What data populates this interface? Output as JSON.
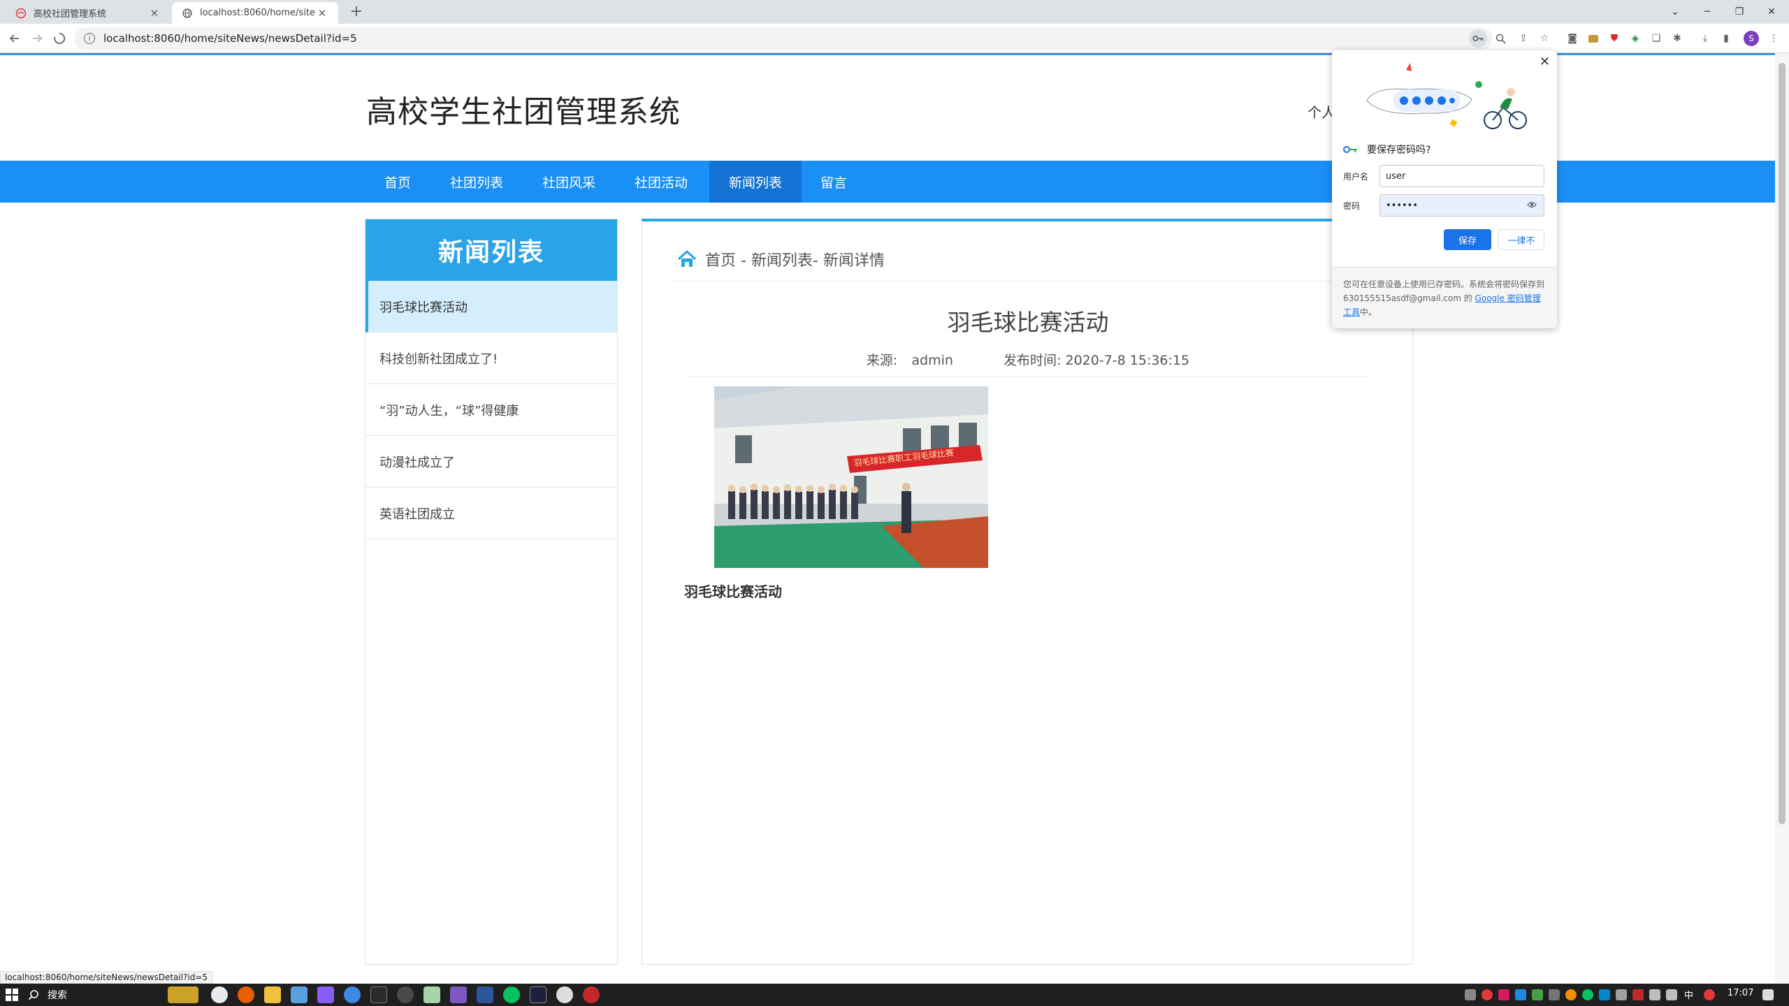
{
  "browser": {
    "tabs": [
      {
        "title": "高校社团管理系统",
        "active": false
      },
      {
        "title": "localhost:8060/home/siteNe",
        "active": true
      }
    ],
    "new_tab_symbol": "+",
    "url": "localhost:8060/home/siteNews/newsDetail?id=5",
    "profile_initial": "S",
    "window_controls": {
      "minimize": "─",
      "restore": "❐",
      "close": "✕",
      "tab_search": "⌄"
    }
  },
  "site": {
    "title": "高校学生社团管理系统",
    "user_link": "个人",
    "nav": [
      "首页",
      "社团列表",
      "社团风采",
      "社团活动",
      "新闻列表",
      "留言"
    ],
    "active_nav": "新闻列表",
    "sidebar": {
      "title": "新闻列表",
      "items": [
        "羽毛球比赛活动",
        "科技创新社团成立了!",
        "“羽”动人生，“球”得健康",
        "动漫社成立了",
        "英语社团成立"
      ]
    },
    "breadcrumb": "首页 - 新闻列表- 新闻详情",
    "article": {
      "title": "羽毛球比赛活动",
      "source_label": "来源:",
      "source": "admin",
      "time_label": "发布时间:",
      "time": "2020-7-8 15:36:15",
      "banner_text": "羽毛球比赛职工羽毛球比赛",
      "caption": "羽毛球比赛活动"
    }
  },
  "password_popup": {
    "question": "要保存密码吗?",
    "username_label": "用户名",
    "username_value": "user",
    "password_label": "密码",
    "password_value": "••••••",
    "save_label": "保存",
    "never_label": "一律不",
    "footer_text": "您可在任意设备上使用已存密码。系统会将密码保存到 630155515asdf@gmail.com 的 ",
    "footer_link": "Google 密码管理工具",
    "footer_end": "中。"
  },
  "status_url": "localhost:8060/home/siteNews/newsDetail?id=5",
  "taskbar": {
    "search_label": "搜索",
    "ime": "中",
    "clock": "17:07"
  },
  "colors": {
    "nav_bg": "#1a8ff5",
    "nav_active": "#1273d4",
    "sidebar_head": "#2aa3e8",
    "sidebar_active": "#d4eefc",
    "chrome_blue": "#1a73e8"
  }
}
